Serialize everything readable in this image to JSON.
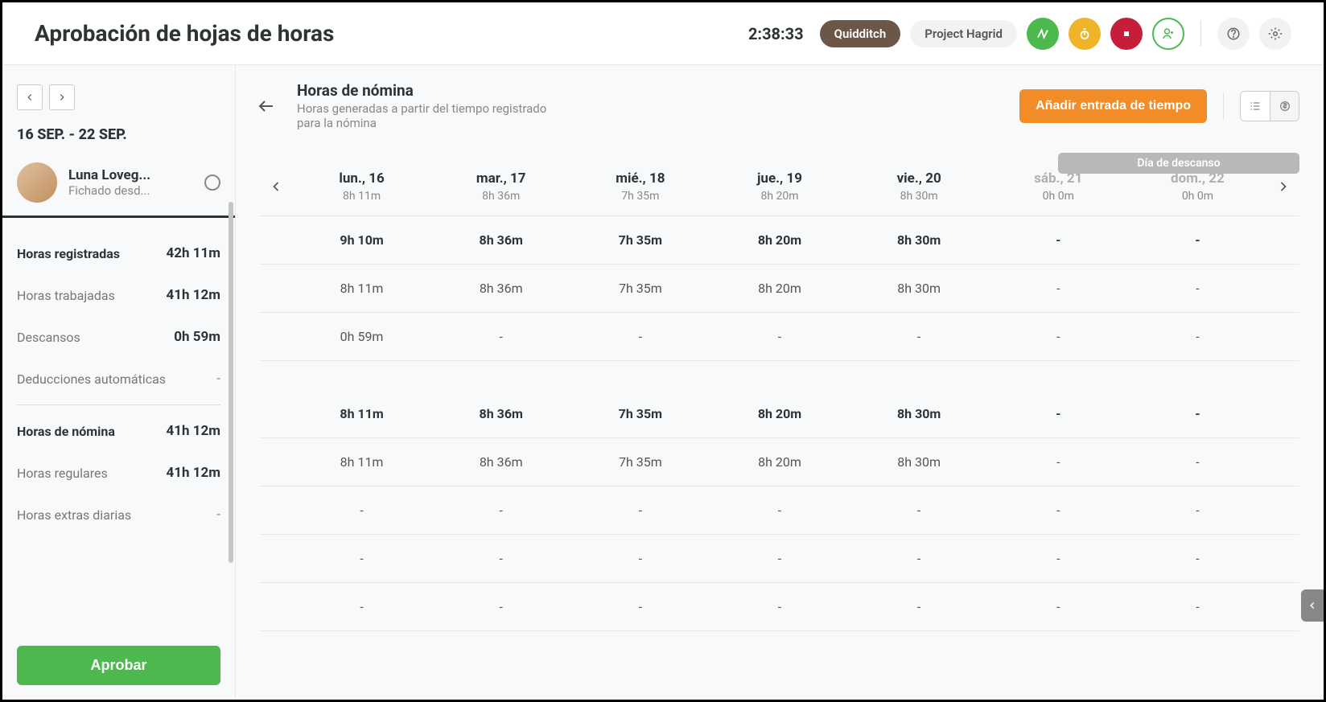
{
  "header": {
    "title": "Aprobación de hojas de horas",
    "timer": "2:38:33",
    "tag1": "Quidditch",
    "tag2": "Project Hagrid"
  },
  "sidebar": {
    "date_range": "16 SEP. - 22 SEP.",
    "user_name": "Luna Loveg...",
    "user_sub": "Fichado desd...",
    "rows": [
      {
        "label": "Horas registradas",
        "value": "42h 11m",
        "bold": true
      },
      {
        "label": "Horas trabajadas",
        "value": "41h 12m"
      },
      {
        "label": "Descansos",
        "value": "0h 59m"
      },
      {
        "label": "Deducciones automáticas",
        "value": "-",
        "muted": true,
        "divider_after": true
      },
      {
        "label": "Horas de nómina",
        "value": "41h 12m",
        "bold": true
      },
      {
        "label": "Horas regulares",
        "value": "41h 12m"
      },
      {
        "label": "Horas extras diarias",
        "value": "-",
        "muted": true
      }
    ],
    "approve": "Aprobar"
  },
  "main": {
    "title": "Horas de nómina",
    "subtitle": "Horas generadas a partir del tiempo registrado para la nómina",
    "add_btn": "Añadir entrada de tiempo",
    "day_off": "Día de descanso",
    "days": [
      {
        "name": "lun., 16",
        "total": "8h 11m"
      },
      {
        "name": "mar., 17",
        "total": "8h 36m"
      },
      {
        "name": "mié., 18",
        "total": "7h 35m"
      },
      {
        "name": "jue., 19",
        "total": "8h 20m"
      },
      {
        "name": "vie., 20",
        "total": "8h 30m"
      },
      {
        "name": "sáb., 21",
        "total": "0h 0m",
        "muted": true
      },
      {
        "name": "dom., 22",
        "total": "0h 0m",
        "muted": true
      }
    ],
    "rows": [
      {
        "bold": true,
        "cells": [
          "9h 10m",
          "8h 36m",
          "7h 35m",
          "8h 20m",
          "8h 30m",
          "-",
          "-"
        ]
      },
      {
        "cells": [
          "8h 11m",
          "8h 36m",
          "7h 35m",
          "8h 20m",
          "8h 30m",
          "-",
          "-"
        ]
      },
      {
        "cells": [
          "0h 59m",
          "-",
          "-",
          "-",
          "-",
          "-",
          "-"
        ]
      },
      {
        "spacer": true
      },
      {
        "bold": true,
        "cells": [
          "8h 11m",
          "8h 36m",
          "7h 35m",
          "8h 20m",
          "8h 30m",
          "-",
          "-"
        ]
      },
      {
        "cells": [
          "8h 11m",
          "8h 36m",
          "7h 35m",
          "8h 20m",
          "8h 30m",
          "-",
          "-"
        ]
      },
      {
        "cells": [
          "-",
          "-",
          "-",
          "-",
          "-",
          "-",
          "-"
        ]
      },
      {
        "cells": [
          "-",
          "-",
          "-",
          "-",
          "-",
          "-",
          "-"
        ]
      },
      {
        "cells": [
          "-",
          "-",
          "-",
          "-",
          "-",
          "-",
          "-"
        ]
      }
    ]
  }
}
